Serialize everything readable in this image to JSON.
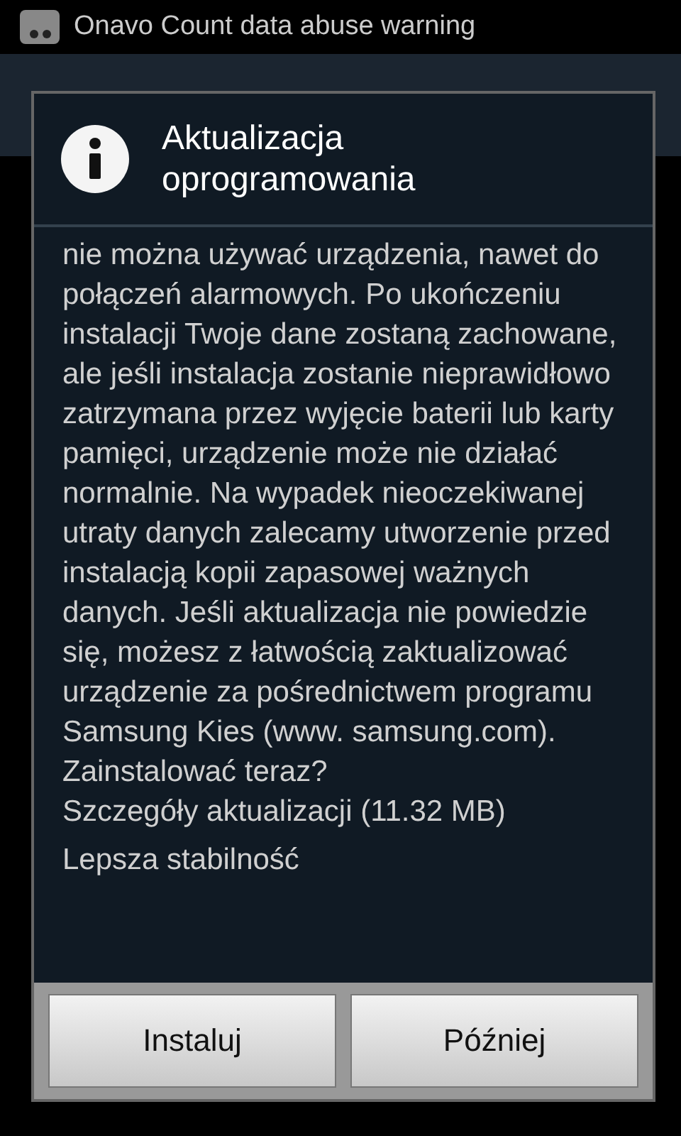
{
  "notification": {
    "title": "Onavo Count data abuse warning"
  },
  "dialog": {
    "title": "Aktualizacja oprogramowania",
    "message": "nie można używać urządzenia, nawet do połączeń alarmowych. Po ukończeniu instalacji Twoje dane zostaną zachowane, ale jeśli instalacja zostanie nieprawidłowo zatrzymana przez wyjęcie baterii lub karty pamięci, urządzenie może nie działać normalnie. Na wypadek nieoczekiwanej utraty danych zalecamy utworzenie przed instalacją kopii zapasowej ważnych danych. Jeśli aktualizacja nie powiedzie się, możesz z łatwością zaktualizować urządzenie za pośrednictwem programu Samsung Kies (www. samsung.com). Zainstalować teraz?",
    "details": "Szczegóły aktualizacji (11.32 MB)",
    "changes": "Lepsza stabilność",
    "buttons": [
      "Instaluj",
      "Później"
    ]
  }
}
